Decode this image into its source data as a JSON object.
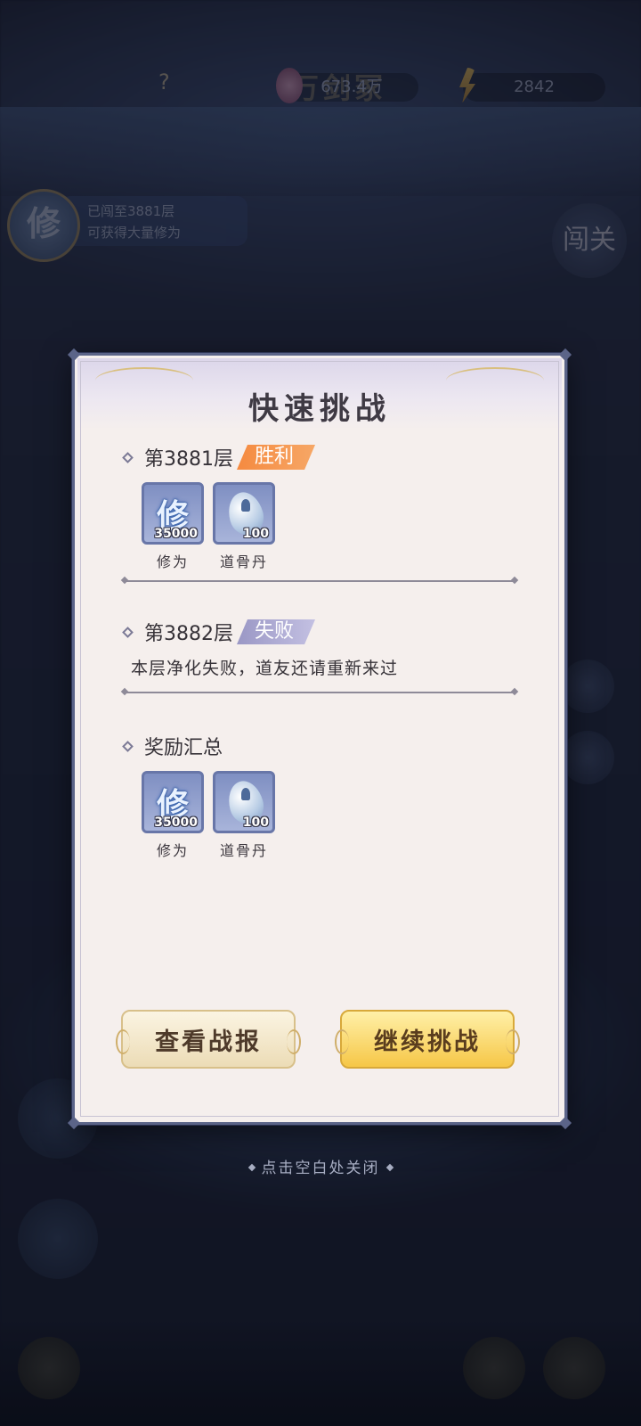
{
  "background": {
    "top_title": "万剑冢",
    "help_glyph": "?",
    "resource1_value": "673.4万",
    "resource2_value": "2842",
    "badge_glyph": "修",
    "badge_line1": "已闯至3881层",
    "badge_line2": "可获得大量修为",
    "circle_right_text": "闯关"
  },
  "dialog": {
    "title": "快速挑战",
    "floor1": {
      "label": "第3881层",
      "result": "胜利",
      "items": [
        {
          "name": "修为",
          "count": "35000",
          "icon": "cultivation-icon",
          "glyph": "修"
        },
        {
          "name": "道骨丹",
          "count": "100",
          "icon": "pill-egg-icon"
        }
      ]
    },
    "floor2": {
      "label": "第3882层",
      "result": "失败",
      "message": "本层净化失败，道友还请重新来过"
    },
    "summary": {
      "label": "奖励汇总",
      "items": [
        {
          "name": "修为",
          "count": "35000",
          "icon": "cultivation-icon",
          "glyph": "修"
        },
        {
          "name": "道骨丹",
          "count": "100",
          "icon": "pill-egg-icon"
        }
      ]
    },
    "buttons": {
      "view_report": "查看战报",
      "continue": "继续挑战"
    }
  },
  "close_hint": "点击空白处关闭",
  "colors": {
    "win_tag": "#f58a40",
    "lose_tag": "#9a97c5",
    "dialog_bg": "#f5efed",
    "dialog_border": "#5b6488",
    "continue_button": "#f6c747"
  }
}
